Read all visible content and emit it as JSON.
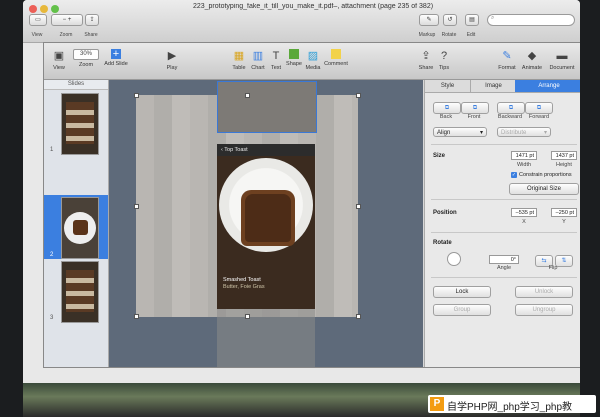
{
  "preview": {
    "title": "223_prototyping_fake_it_till_you_make_it.pdf–, attachment (page 235 of 382)",
    "toolbar_labels": {
      "view": "View",
      "zoom": "Zoom",
      "share": "Share",
      "markup": "Markup",
      "rotate": "Rotate",
      "edit": "Edit"
    }
  },
  "keynote": {
    "toolbar": {
      "view": "View",
      "zoom": "Zoom",
      "zoom_value": "30%",
      "add_slide": "Add Slide",
      "play": "Play",
      "table": "Table",
      "chart": "Chart",
      "text": "Text",
      "shape": "Shape",
      "media": "Media",
      "comment": "Comment",
      "share": "Share",
      "tips": "Tips",
      "format": "Format",
      "animate": "Animate",
      "document": "Document"
    },
    "slides_header": "Slides",
    "slide_numbers": [
      "1",
      "2",
      "3"
    ],
    "slide": {
      "nav_back": "Top Toast",
      "caption_title": "Smashed Toast",
      "caption_sub": "Butter, Foie Gras"
    },
    "inspector": {
      "tabs": [
        "Style",
        "Image",
        "Arrange"
      ],
      "order": {
        "back": "Back",
        "front": "Front",
        "backward": "Backward",
        "forward": "Forward"
      },
      "align": "Align",
      "distribute": "Distribute",
      "size_label": "Size",
      "width": "1471 pt",
      "height": "1437 pt",
      "width_lbl": "Width",
      "height_lbl": "Height",
      "constrain": "Constrain proportions",
      "original_size": "Original Size",
      "position_label": "Position",
      "x": "–535 pt",
      "y": "–250 pt",
      "x_lbl": "X",
      "y_lbl": "Y",
      "rotate_label": "Rotate",
      "angle": "0°",
      "angle_lbl": "Angle",
      "flip_lbl": "Flip",
      "lock": "Lock",
      "unlock": "Unlock",
      "group": "Group",
      "ungroup": "Ungroup"
    }
  },
  "watermark": {
    "text": "自学PHP网_php学习_php教"
  },
  "colors": {
    "accent": "#3b7fe0",
    "selection": "#3a78d6"
  }
}
